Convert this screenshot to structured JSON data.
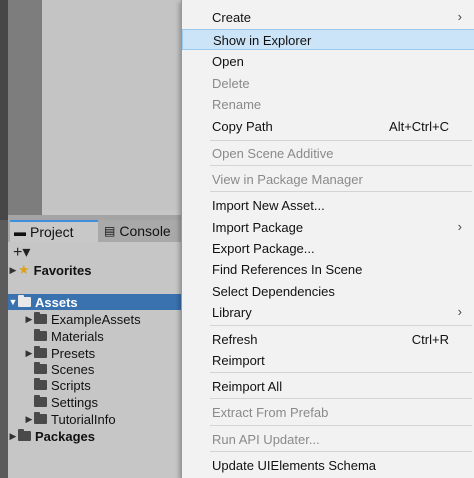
{
  "project_panel": {
    "tabs": [
      {
        "label": "Project",
        "icon": "folder-icon"
      },
      {
        "label": "Console",
        "icon": "console-icon"
      }
    ],
    "add_button": "+▾",
    "tree": [
      {
        "label": "Favorites",
        "icon": "star-icon",
        "expanded": false
      },
      {
        "label": "Assets",
        "icon": "folder-icon",
        "expanded": true,
        "selected": true
      },
      {
        "label": "ExampleAssets",
        "icon": "folder-icon",
        "expandable": true
      },
      {
        "label": "Materials",
        "icon": "folder-icon"
      },
      {
        "label": "Presets",
        "icon": "folder-icon",
        "expandable": true
      },
      {
        "label": "Scenes",
        "icon": "folder-icon"
      },
      {
        "label": "Scripts",
        "icon": "folder-icon"
      },
      {
        "label": "Settings",
        "icon": "folder-icon"
      },
      {
        "label": "TutorialInfo",
        "icon": "folder-icon",
        "expandable": true
      },
      {
        "label": "Packages",
        "icon": "folder-icon",
        "expandable": true
      }
    ]
  },
  "context_menu": {
    "items": [
      {
        "label": "Create",
        "submenu": true
      },
      {
        "label": "Show in Explorer",
        "highlighted": true
      },
      {
        "label": "Open"
      },
      {
        "label": "Delete",
        "disabled": true
      },
      {
        "label": "Rename",
        "disabled": true
      },
      {
        "label": "Copy Path",
        "shortcut": "Alt+Ctrl+C"
      },
      {
        "label": "Open Scene Additive",
        "disabled": true
      },
      {
        "label": "View in Package Manager",
        "disabled": true
      },
      {
        "label": "Import New Asset..."
      },
      {
        "label": "Import Package",
        "submenu": true
      },
      {
        "label": "Export Package..."
      },
      {
        "label": "Find References In Scene"
      },
      {
        "label": "Select Dependencies"
      },
      {
        "label": "Library",
        "submenu": true
      },
      {
        "label": "Refresh",
        "shortcut": "Ctrl+R"
      },
      {
        "label": "Reimport"
      },
      {
        "label": "Reimport All"
      },
      {
        "label": "Extract From Prefab",
        "disabled": true
      },
      {
        "label": "Run API Updater...",
        "disabled": true
      },
      {
        "label": "Update UIElements Schema"
      }
    ]
  }
}
